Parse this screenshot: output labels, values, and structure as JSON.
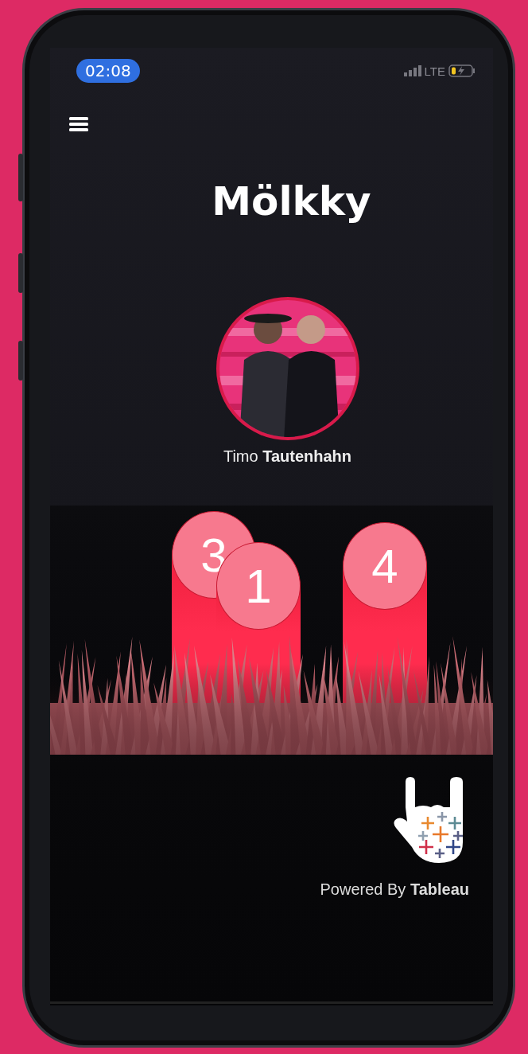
{
  "status_bar": {
    "time": "02:08",
    "network": "LTE"
  },
  "title": "Mölkky",
  "player": {
    "name": "Timo **Tautenhahn**"
  },
  "pins": [
    {
      "number": "3"
    },
    {
      "number": "1"
    },
    {
      "number": "4"
    }
  ],
  "footer": {
    "credit": "Powered By **Tableau**"
  }
}
